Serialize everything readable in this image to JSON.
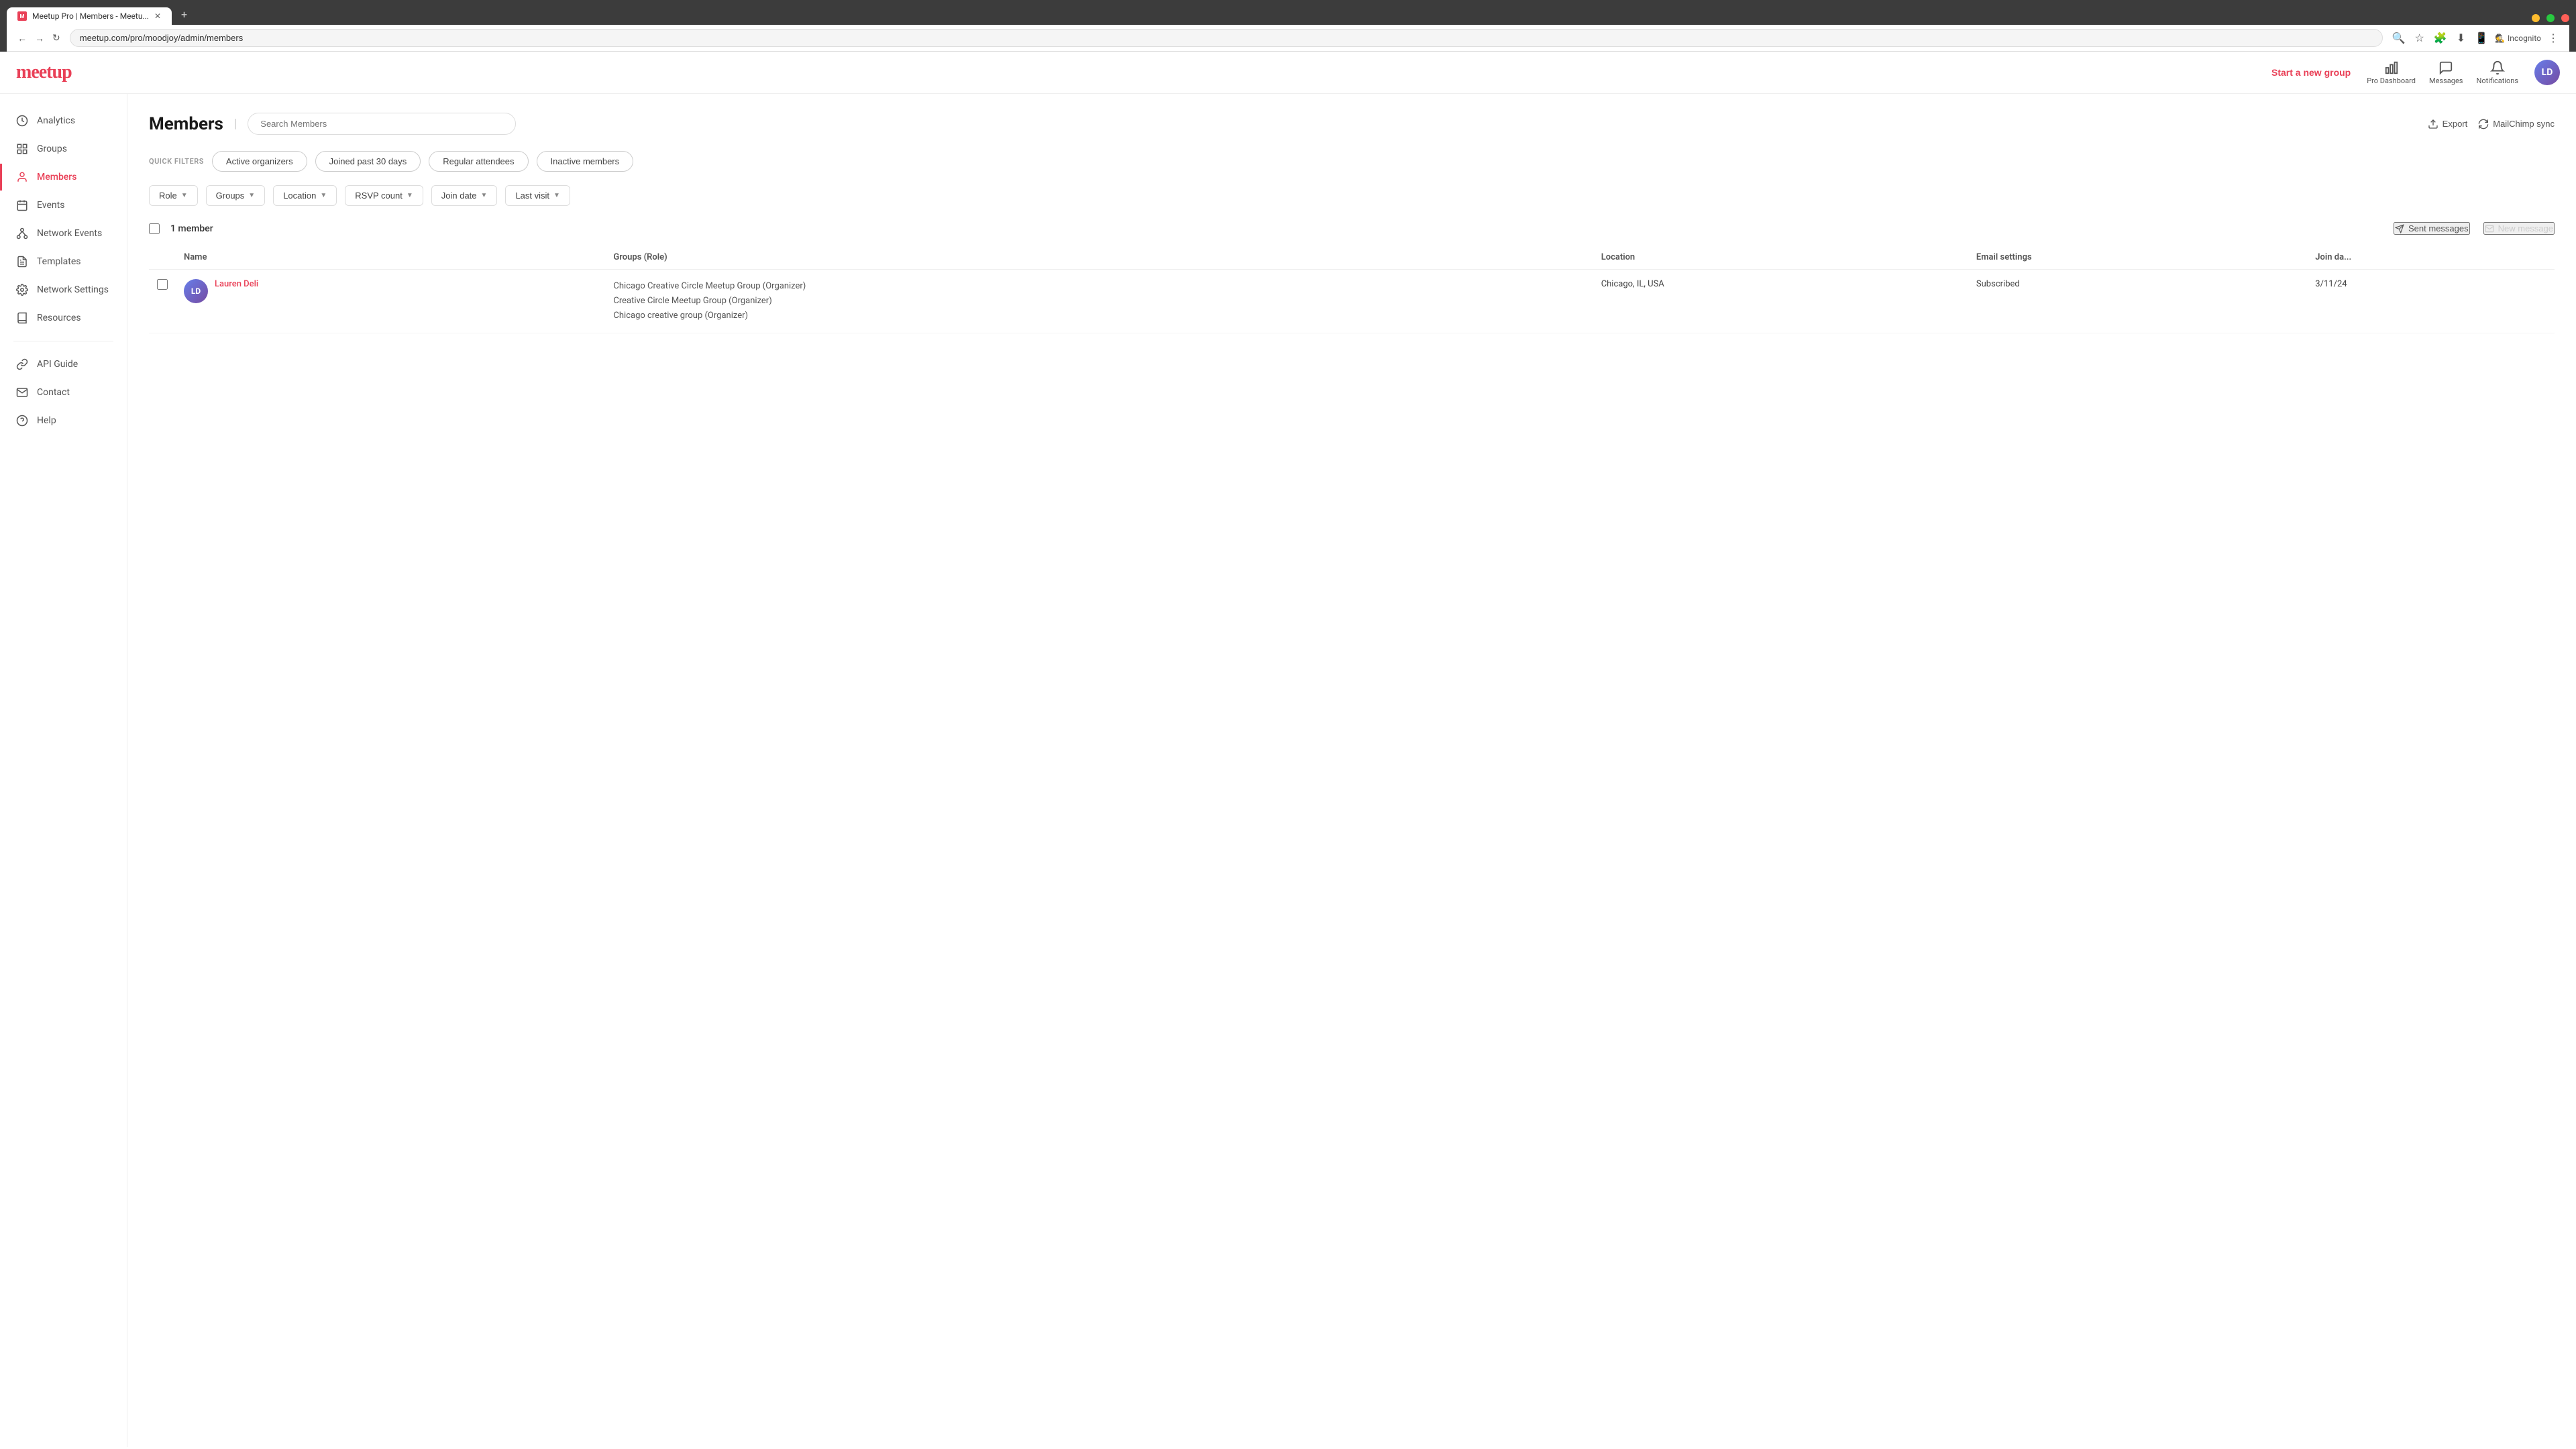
{
  "browser": {
    "tab_title": "Meetup Pro | Members - Meetu...",
    "url": "meetup.com/pro/moodjoy/admin/members",
    "incognito_label": "Incognito",
    "new_tab_symbol": "+"
  },
  "topbar": {
    "logo": "meetup",
    "start_new_group_label": "Start a new group",
    "pro_dashboard_label": "Pro Dashboard",
    "messages_label": "Messages",
    "notifications_label": "Notifications"
  },
  "sidebar": {
    "items": [
      {
        "id": "analytics",
        "label": "Analytics",
        "icon": "chart"
      },
      {
        "id": "groups",
        "label": "Groups",
        "icon": "grid"
      },
      {
        "id": "members",
        "label": "Members",
        "icon": "person",
        "active": true
      },
      {
        "id": "events",
        "label": "Events",
        "icon": "calendar"
      },
      {
        "id": "network-events",
        "label": "Network Events",
        "icon": "network"
      },
      {
        "id": "templates",
        "label": "Templates",
        "icon": "template"
      },
      {
        "id": "network-settings",
        "label": "Network Settings",
        "icon": "settings"
      },
      {
        "id": "resources",
        "label": "Resources",
        "icon": "book"
      }
    ],
    "bottom_items": [
      {
        "id": "api-guide",
        "label": "API Guide",
        "icon": "link"
      },
      {
        "id": "contact",
        "label": "Contact",
        "icon": "envelope"
      },
      {
        "id": "help",
        "label": "Help",
        "icon": "question"
      }
    ]
  },
  "page": {
    "title": "Members",
    "search_placeholder": "Search Members"
  },
  "header_actions": {
    "export_label": "Export",
    "mailchimp_label": "MailChimp sync"
  },
  "quick_filters": {
    "label": "QUICK FILTERS",
    "chips": [
      {
        "id": "active-organizers",
        "label": "Active organizers"
      },
      {
        "id": "joined-past-30",
        "label": "Joined past 30 days"
      },
      {
        "id": "regular-attendees",
        "label": "Regular attendees"
      },
      {
        "id": "inactive-members",
        "label": "Inactive members"
      }
    ]
  },
  "dropdown_filters": [
    {
      "id": "role",
      "label": "Role"
    },
    {
      "id": "groups",
      "label": "Groups"
    },
    {
      "id": "location",
      "label": "Location"
    },
    {
      "id": "rsvp-count",
      "label": "RSVP count"
    },
    {
      "id": "join-date",
      "label": "Join date"
    },
    {
      "id": "last-visit",
      "label": "Last visit"
    }
  ],
  "members_list": {
    "count_label": "1 member",
    "sent_messages_label": "Sent messages",
    "new_message_label": "New message",
    "table": {
      "columns": [
        {
          "id": "name",
          "label": "Name"
        },
        {
          "id": "groups",
          "label": "Groups (Role)"
        },
        {
          "id": "location",
          "label": "Location"
        },
        {
          "id": "email",
          "label": "Email settings"
        },
        {
          "id": "joindate",
          "label": "Join da..."
        }
      ],
      "rows": [
        {
          "name": "Lauren Deli",
          "avatar_initials": "LD",
          "groups": [
            "Chicago Creative Circle Meetup Group (Organizer)",
            "Creative Circle Meetup Group (Organizer)",
            "Chicago creative group (Organizer)"
          ],
          "location": "Chicago, IL, USA",
          "email_settings": "Subscribed",
          "join_date": "3/11/24"
        }
      ]
    }
  },
  "colors": {
    "brand_red": "#e94057",
    "sidebar_active_color": "#e94057",
    "link_color": "#e94057"
  }
}
